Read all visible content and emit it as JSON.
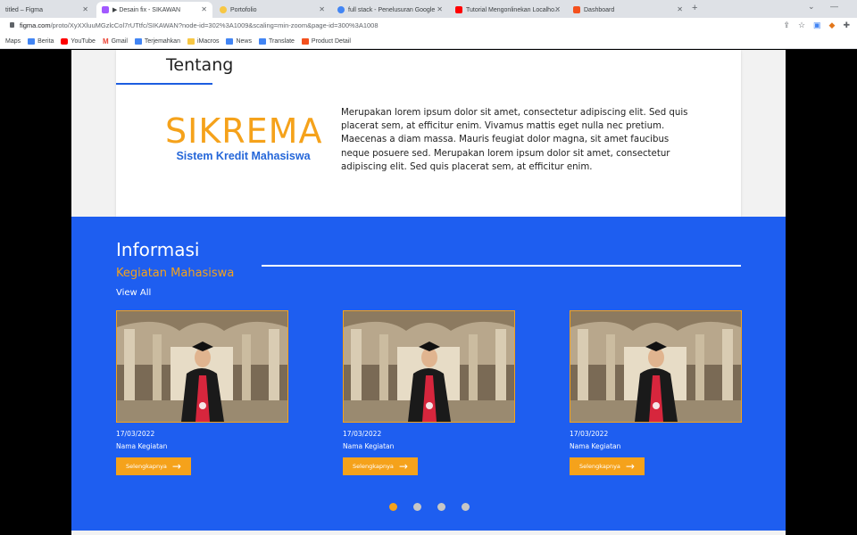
{
  "browser": {
    "tabs": [
      {
        "label": "titled – Figma",
        "color": "#ffffff"
      },
      {
        "label": "▶ Desain fix - SIKAWAN",
        "color": "#a259ff"
      },
      {
        "label": "Portofolio",
        "color": "#f7c744"
      },
      {
        "label": "full stack - Penelusuran Google",
        "color": "#4285f4"
      },
      {
        "label": "Tutorial Mengonlinekan Localho...",
        "color": "#ff0000"
      },
      {
        "label": "Dashboard",
        "color": "#f4511e"
      }
    ],
    "url_host": "figma.com",
    "url_path": "/proto/XyXXluuMGzlcCol7rUTtfc/SIKAWAN?node-id=302%3A1009&scaling=min-zoom&page-id=300%3A1008",
    "bookmarks": [
      {
        "label": "Maps",
        "icon": "maps-icon",
        "color": "#34a853"
      },
      {
        "label": "Berita",
        "icon": "news-icon",
        "color": "#4285f4"
      },
      {
        "label": "YouTube",
        "icon": "youtube-icon",
        "color": "#ff0000"
      },
      {
        "label": "Gmail",
        "icon": "gmail-icon",
        "color": "#ea4335"
      },
      {
        "label": "Terjemahkan",
        "icon": "translate-icon",
        "color": "#4285f4"
      },
      {
        "label": "iMacros",
        "icon": "imacros-icon",
        "color": "#f7c744"
      },
      {
        "label": "News",
        "icon": "news-icon",
        "color": "#4285f4"
      },
      {
        "label": "Translate",
        "icon": "translate-icon",
        "color": "#4285f4"
      },
      {
        "label": "Product Detail",
        "icon": "product-icon",
        "color": "#f4511e"
      }
    ]
  },
  "tentang": {
    "title": "Tentang",
    "brand": "SIKREMA",
    "brand_sub": "Sistem Kredit Mahasiswa",
    "description": "Merupakan lorem ipsum dolor sit amet, consectetur adipiscing elit. Sed quis placerat sem, at efficitur enim. Vivamus mattis eget nulla nec pretium. Maecenas a diam massa. Mauris feugiat dolor magna, sit amet faucibus neque posuere sed. Merupakan lorem ipsum dolor sit amet, consectetur adipiscing elit. Sed quis placerat sem, at efficitur enim."
  },
  "informasi": {
    "title": "Informasi",
    "subtitle": "Kegiatan Mahasiswa",
    "view_all": "View All",
    "events": [
      {
        "date": "17/03/2022",
        "name": "Nama Kegiatan",
        "button": "Selengkapnya"
      },
      {
        "date": "17/03/2022",
        "name": "Nama Kegiatan",
        "button": "Selengkapnya"
      },
      {
        "date": "17/03/2022",
        "name": "Nama Kegiatan",
        "button": "Selengkapnya"
      }
    ],
    "carousel_active": 1,
    "carousel_count": 4
  },
  "colors": {
    "accent": "#f5a21b",
    "primary": "#1e5ef0",
    "brand_blue": "#2567d9"
  }
}
